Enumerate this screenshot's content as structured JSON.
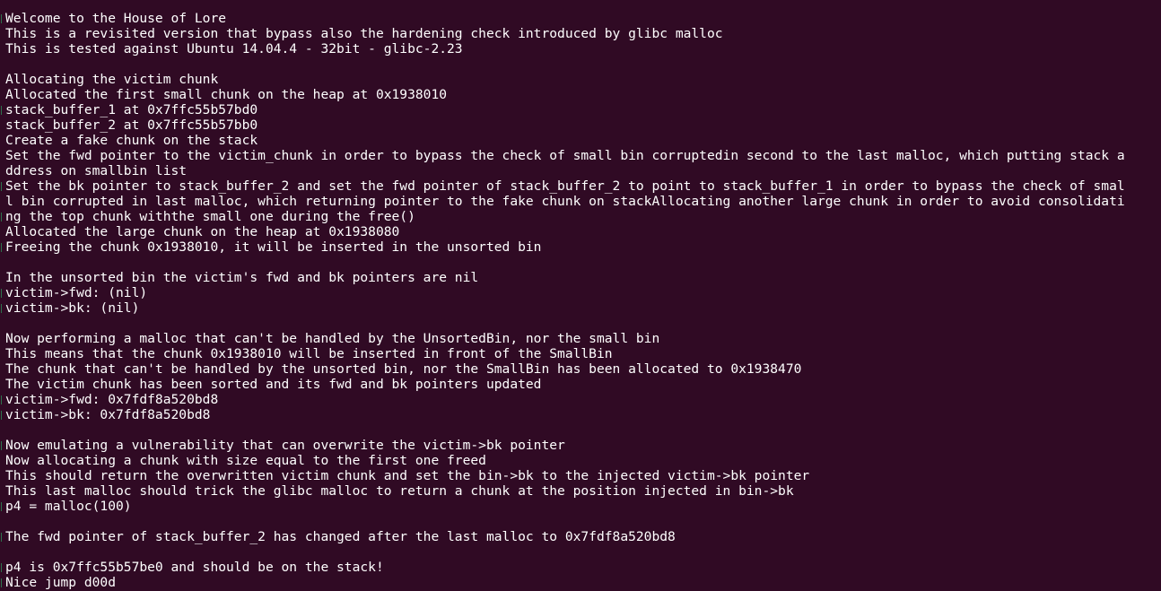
{
  "terminal": {
    "lines": [
      "Welcome to the House of Lore",
      "This is a revisited version that bypass also the hardening check introduced by glibc malloc",
      "This is tested against Ubuntu 14.04.4 - 32bit - glibc-2.23",
      "",
      "Allocating the victim chunk",
      "Allocated the first small chunk on the heap at 0x1938010",
      "stack_buffer_1 at 0x7ffc55b57bd0",
      "stack_buffer_2 at 0x7ffc55b57bb0",
      "Create a fake chunk on the stack",
      "Set the fwd pointer to the victim_chunk in order to bypass the check of small bin corruptedin second to the last malloc, which putting stack a",
      "ddress on smallbin list",
      "Set the bk pointer to stack_buffer_2 and set the fwd pointer of stack_buffer_2 to point to stack_buffer_1 in order to bypass the check of smal",
      "l bin corrupted in last malloc, which returning pointer to the fake chunk on stackAllocating another large chunk in order to avoid consolidati",
      "ng the top chunk withthe small one during the free()",
      "Allocated the large chunk on the heap at 0x1938080",
      "Freeing the chunk 0x1938010, it will be inserted in the unsorted bin",
      "",
      "In the unsorted bin the victim's fwd and bk pointers are nil",
      "victim->fwd: (nil)",
      "victim->bk: (nil)",
      "",
      "Now performing a malloc that can't be handled by the UnsortedBin, nor the small bin",
      "This means that the chunk 0x1938010 will be inserted in front of the SmallBin",
      "The chunk that can't be handled by the unsorted bin, nor the SmallBin has been allocated to 0x1938470",
      "The victim chunk has been sorted and its fwd and bk pointers updated",
      "victim->fwd: 0x7fdf8a520bd8",
      "victim->bk: 0x7fdf8a520bd8",
      "",
      "Now emulating a vulnerability that can overwrite the victim->bk pointer",
      "Now allocating a chunk with size equal to the first one freed",
      "This should return the overwritten victim chunk and set the bin->bk to the injected victim->bk pointer",
      "This last malloc should trick the glibc malloc to return a chunk at the position injected in bin->bk",
      "p4 = malloc(100)",
      "",
      "The fwd pointer of stack_buffer_2 has changed after the last malloc to 0x7fdf8a520bd8",
      "",
      "p4 is 0x7ffc55b57be0 and should be on the stack!",
      "Nice jump d00d"
    ]
  },
  "colors": {
    "background": "#300a24",
    "foreground": "#ffffff",
    "margin_mark": "#2e8b57"
  }
}
